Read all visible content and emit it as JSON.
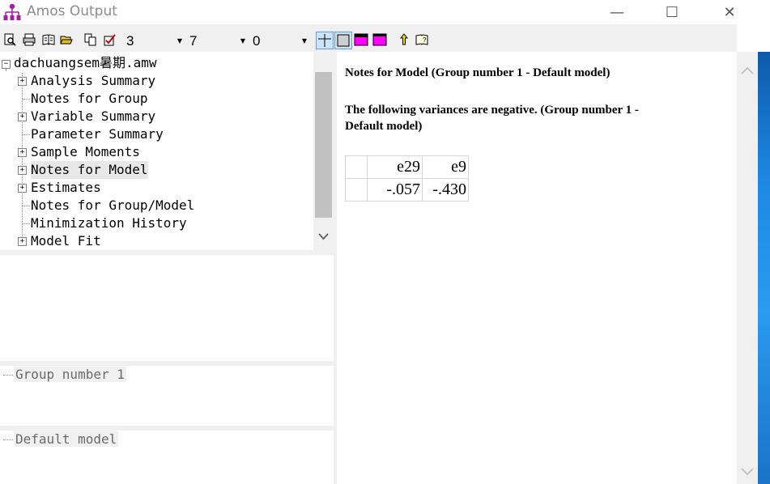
{
  "window": {
    "title": "Amos Output",
    "minimize_glyph": "—",
    "maximize_glyph": "☐",
    "close_glyph": "✕"
  },
  "toolbar": {
    "icons": [
      "print-preview-icon",
      "print-icon",
      "open-book-icon",
      "open-folder-icon",
      "copy-icon",
      "checklist-icon"
    ],
    "decimals_value": "3",
    "width_value": "7",
    "third_value": "0",
    "right_icons": [
      "grid-lines-icon",
      "table-border-icon",
      "magenta-header-icon",
      "magenta-table-icon",
      "pointer-icon",
      "help-book-icon"
    ]
  },
  "tree": {
    "root": "dachuangsem暑期.amw",
    "items": [
      {
        "label": "Analysis Summary",
        "expandable": true
      },
      {
        "label": "Notes for Group",
        "expandable": false
      },
      {
        "label": "Variable Summary",
        "expandable": true
      },
      {
        "label": "Parameter Summary",
        "expandable": false
      },
      {
        "label": "Sample Moments",
        "expandable": true
      },
      {
        "label": "Notes for Model",
        "expandable": true,
        "selected": true
      },
      {
        "label": "Estimates",
        "expandable": true
      },
      {
        "label": "Notes for Group/Model",
        "expandable": false
      },
      {
        "label": "Minimization History",
        "expandable": false
      },
      {
        "label": "Model Fit",
        "expandable": true
      }
    ]
  },
  "groups_pane": {
    "item": "Group number 1"
  },
  "models_pane": {
    "item": "Default model"
  },
  "output": {
    "title": "Notes for Model (Group number 1 - Default model)",
    "subheading_line1": "The following variances are negative. (Group number 1 -",
    "subheading_line2": "Default model)",
    "table": {
      "headers": [
        "e29",
        "e9"
      ],
      "values": [
        "-.057",
        "-.430"
      ]
    }
  },
  "colors": {
    "selected_bg": "#e8e8e8",
    "toolbar_bg": "#f0f0f0",
    "magenta": "#ff00ff"
  }
}
